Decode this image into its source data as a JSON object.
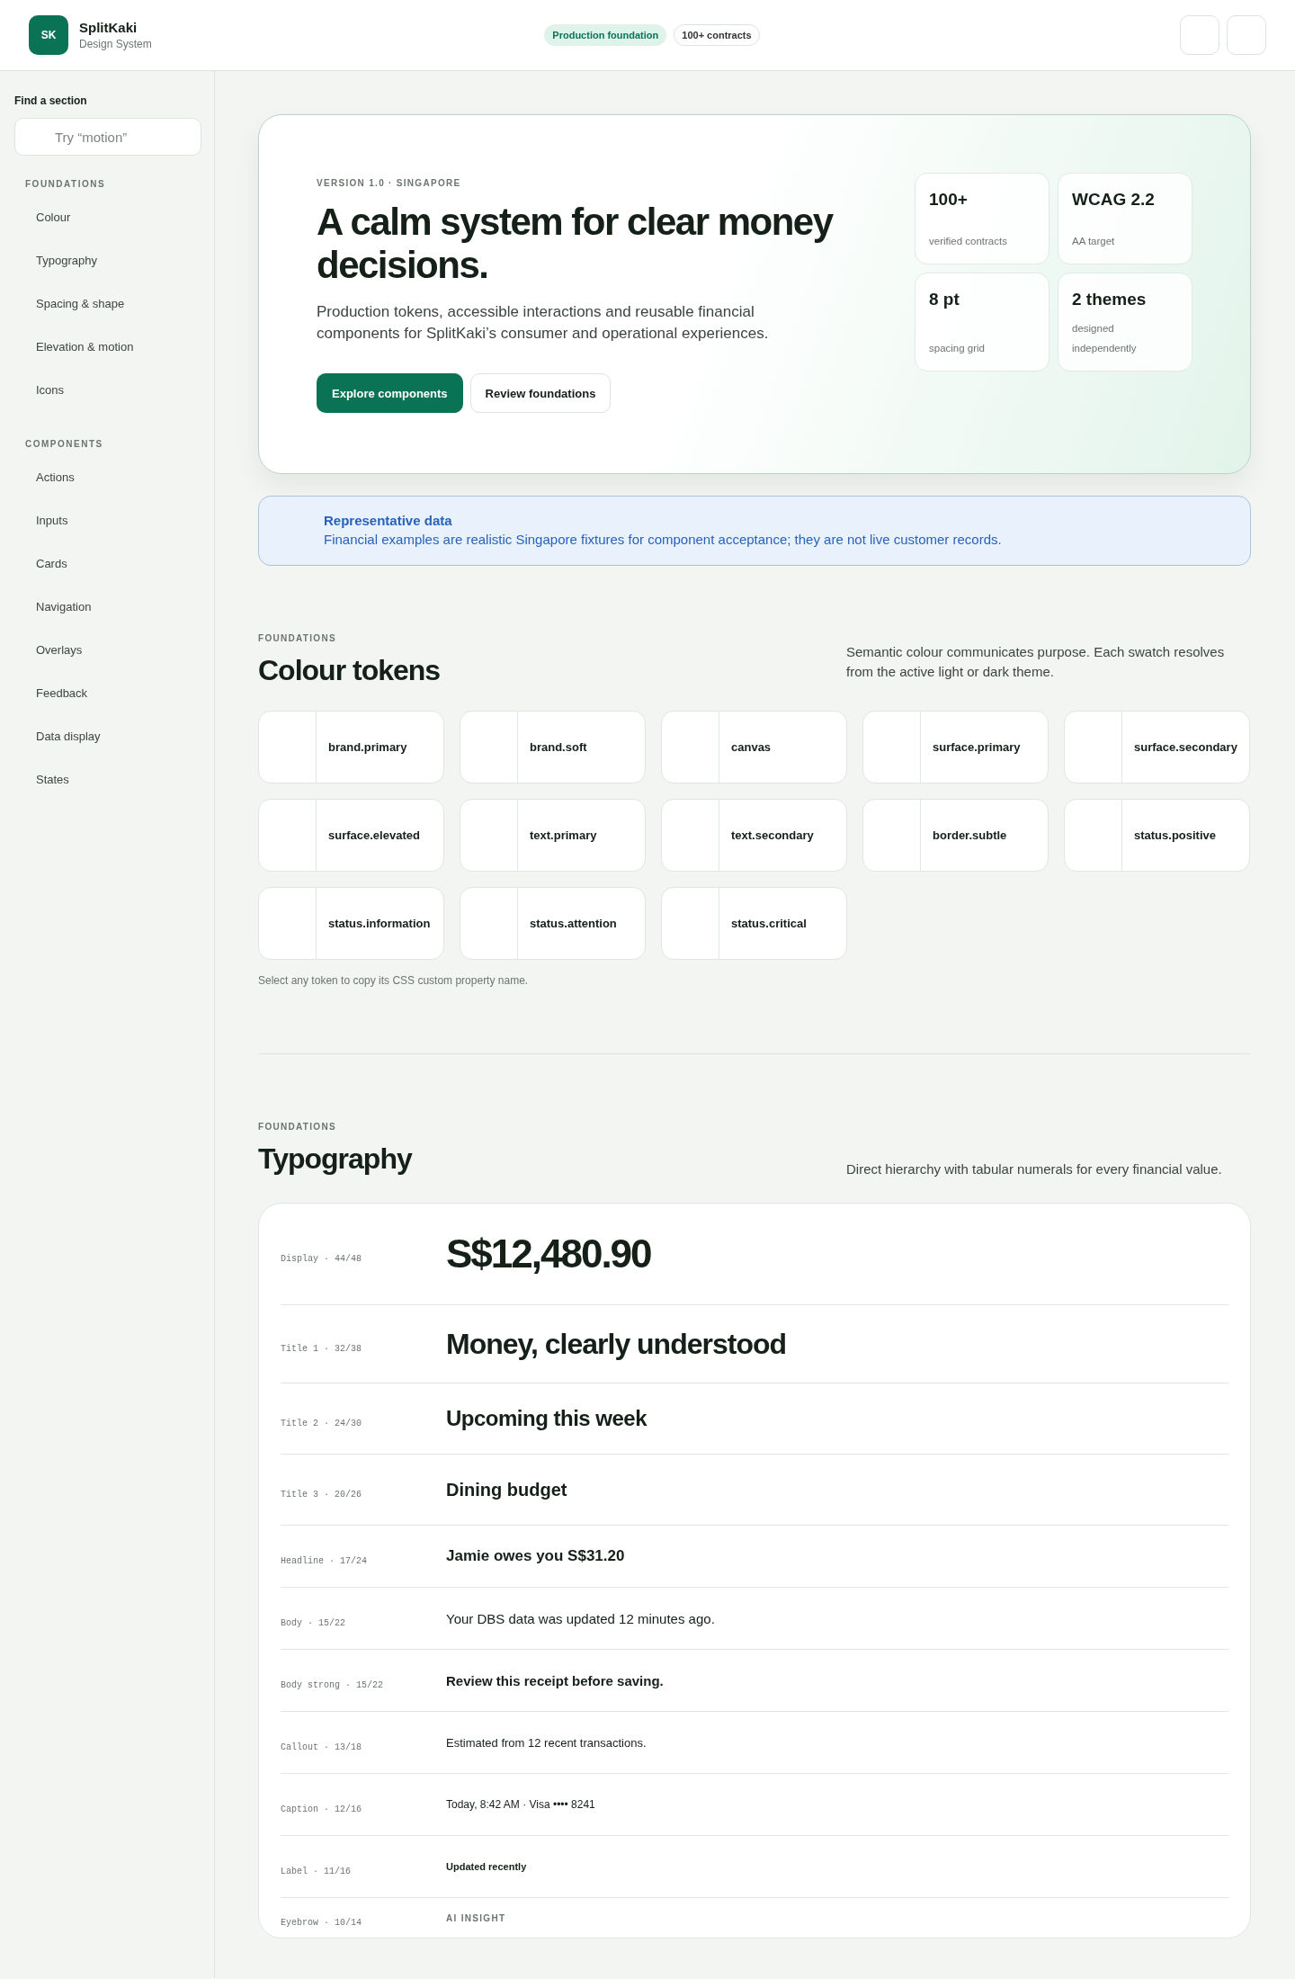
{
  "header": {
    "logo": "SK",
    "brand": "SplitKaki",
    "subtitle": "Design System",
    "badges": [
      {
        "label": "Production foundation",
        "kind": "accent"
      },
      {
        "label": "100+ contracts",
        "kind": "outline"
      }
    ]
  },
  "sidebar": {
    "title": "Find a section",
    "search": {
      "placeholder": "Try “motion”"
    },
    "groups": [
      {
        "heading": "FOUNDATIONS",
        "items": [
          "Colour",
          "Typography",
          "Spacing & shape",
          "Elevation & motion",
          "Icons"
        ]
      },
      {
        "heading": "COMPONENTS",
        "items": [
          "Actions",
          "Inputs",
          "Cards",
          "Navigation",
          "Overlays",
          "Feedback",
          "Data display",
          "States"
        ]
      }
    ]
  },
  "hero": {
    "eyebrow": "VERSION 1.0 · SINGAPORE",
    "title": "A calm system for clear money decisions.",
    "lead": "Production tokens, accessible interactions and reusable financial components for SplitKaki’s consumer and operational experiences.",
    "buttons": [
      {
        "label": "Explore components",
        "kind": "primary"
      },
      {
        "label": "Review foundations",
        "kind": "secondary"
      }
    ],
    "stats": [
      {
        "value": "100+",
        "label": "verified contracts"
      },
      {
        "value": "WCAG 2.2",
        "label": "AA target"
      },
      {
        "value": "8 pt",
        "label": "spacing grid"
      },
      {
        "value": "2 themes",
        "label": "designed independently"
      }
    ]
  },
  "notice": {
    "title": "Representative data",
    "text": "Financial examples are realistic Singapore fixtures for component acceptance; they are not live customer records."
  },
  "colour_section": {
    "eyebrow": "FOUNDATIONS",
    "title": "Colour tokens",
    "description": "Semantic colour communicates purpose. Each swatch resolves from the active light or dark theme.",
    "tokens": [
      "brand.primary",
      "brand.soft",
      "canvas",
      "surface.primary",
      "surface.secondary",
      "surface.elevated",
      "text.primary",
      "text.secondary",
      "border.subtle",
      "status.positive",
      "status.information",
      "status.attention",
      "status.critical"
    ],
    "note": "Select any token to copy its CSS custom property name."
  },
  "typography_section": {
    "eyebrow": "FOUNDATIONS",
    "title": "Typography",
    "description": "Direct hierarchy with tabular numerals for every financial value.",
    "rows": [
      {
        "spec": "Display · 44/48",
        "sample": "S$12,480.90",
        "kind": "display"
      },
      {
        "spec": "Title 1 · 32/38",
        "sample": "Money, clearly understood",
        "kind": "title1"
      },
      {
        "spec": "Title 2 · 24/30",
        "sample": "Upcoming this week",
        "kind": "title2"
      },
      {
        "spec": "Title 3 · 20/26",
        "sample": "Dining budget",
        "kind": "title3"
      },
      {
        "spec": "Headline · 17/24",
        "sample": "Jamie owes you S$31.20",
        "kind": "headline"
      },
      {
        "spec": "Body · 15/22",
        "sample": "Your DBS data was updated 12 minutes ago.",
        "kind": "body"
      },
      {
        "spec": "Body strong · 15/22",
        "sample": "Review this receipt before saving.",
        "kind": "bodystrong"
      },
      {
        "spec": "Callout · 13/18",
        "sample": "Estimated from 12 recent transactions.",
        "kind": "callout"
      },
      {
        "spec": "Caption · 12/16",
        "sample": "Today, 8:42 AM · Visa •••• 8241",
        "kind": "caption"
      },
      {
        "spec": "Label · 11/16",
        "sample": "Updated recently",
        "kind": "label"
      },
      {
        "spec": "Eyebrow · 10/14",
        "sample": "AI INSIGHT",
        "kind": "eyebrow"
      }
    ]
  }
}
